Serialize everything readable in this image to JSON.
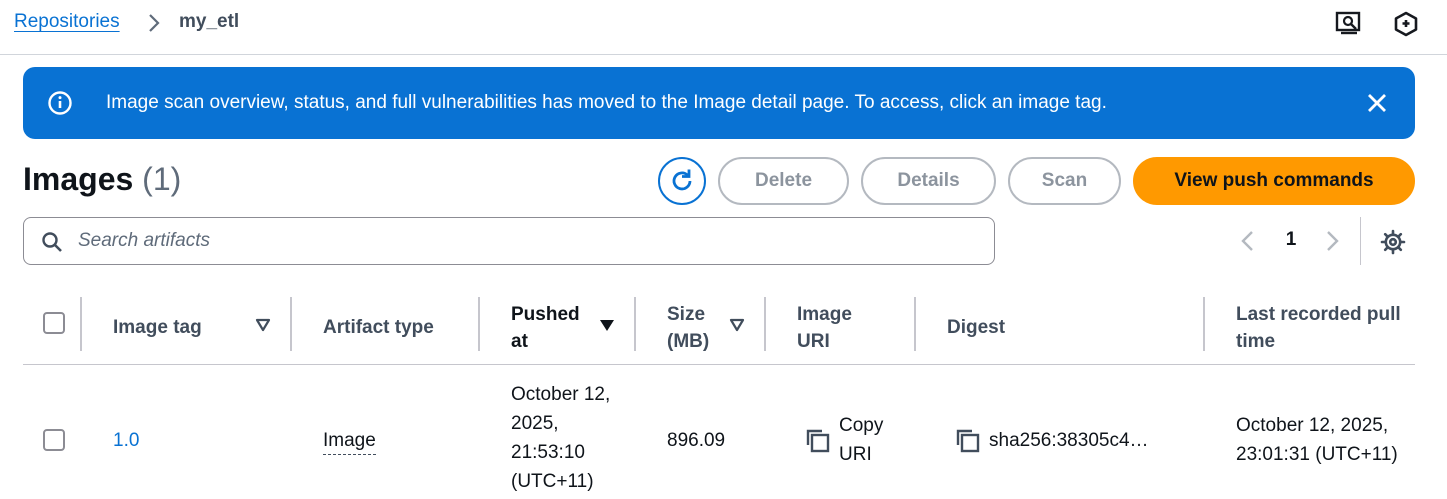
{
  "breadcrumb": {
    "parent": "Repositories",
    "current": "my_etl"
  },
  "top_icons": [
    "screen-inspect-icon",
    "hexagon-feedback-icon"
  ],
  "flash": {
    "message": "Image scan overview, status, and full vulnerabilities has moved to the Image detail page. To access, click an image tag.",
    "color": "#0972d3"
  },
  "header": {
    "title": "Images",
    "count": "(1)",
    "buttons": {
      "delete": "Delete",
      "details": "Details",
      "scan": "Scan",
      "push": "View push commands"
    }
  },
  "search": {
    "placeholder": "Search artifacts",
    "value": ""
  },
  "pagination": {
    "current_page": "1"
  },
  "table": {
    "columns": {
      "image_tag": "Image tag",
      "artifact_type": "Artifact type",
      "pushed_at": "Pushed at",
      "size": "Size (MB)",
      "image_uri": "Image URI",
      "digest": "Digest",
      "last_pull": "Last recorded pull time"
    },
    "rows": [
      {
        "image_tag": "1.0",
        "artifact_type": "Image",
        "pushed_at": "October 12, 2025, 21:53:10 (UTC+11)",
        "size": "896.09",
        "image_uri": "Copy URI",
        "digest": "sha256:38305c4…",
        "last_pull": "October 12, 2025, 23:01:31 (UTC+11)"
      }
    ]
  },
  "colors": {
    "accent": "#0972d3",
    "primary_button": "#ff9900",
    "disabled_text": "#8c949e"
  }
}
